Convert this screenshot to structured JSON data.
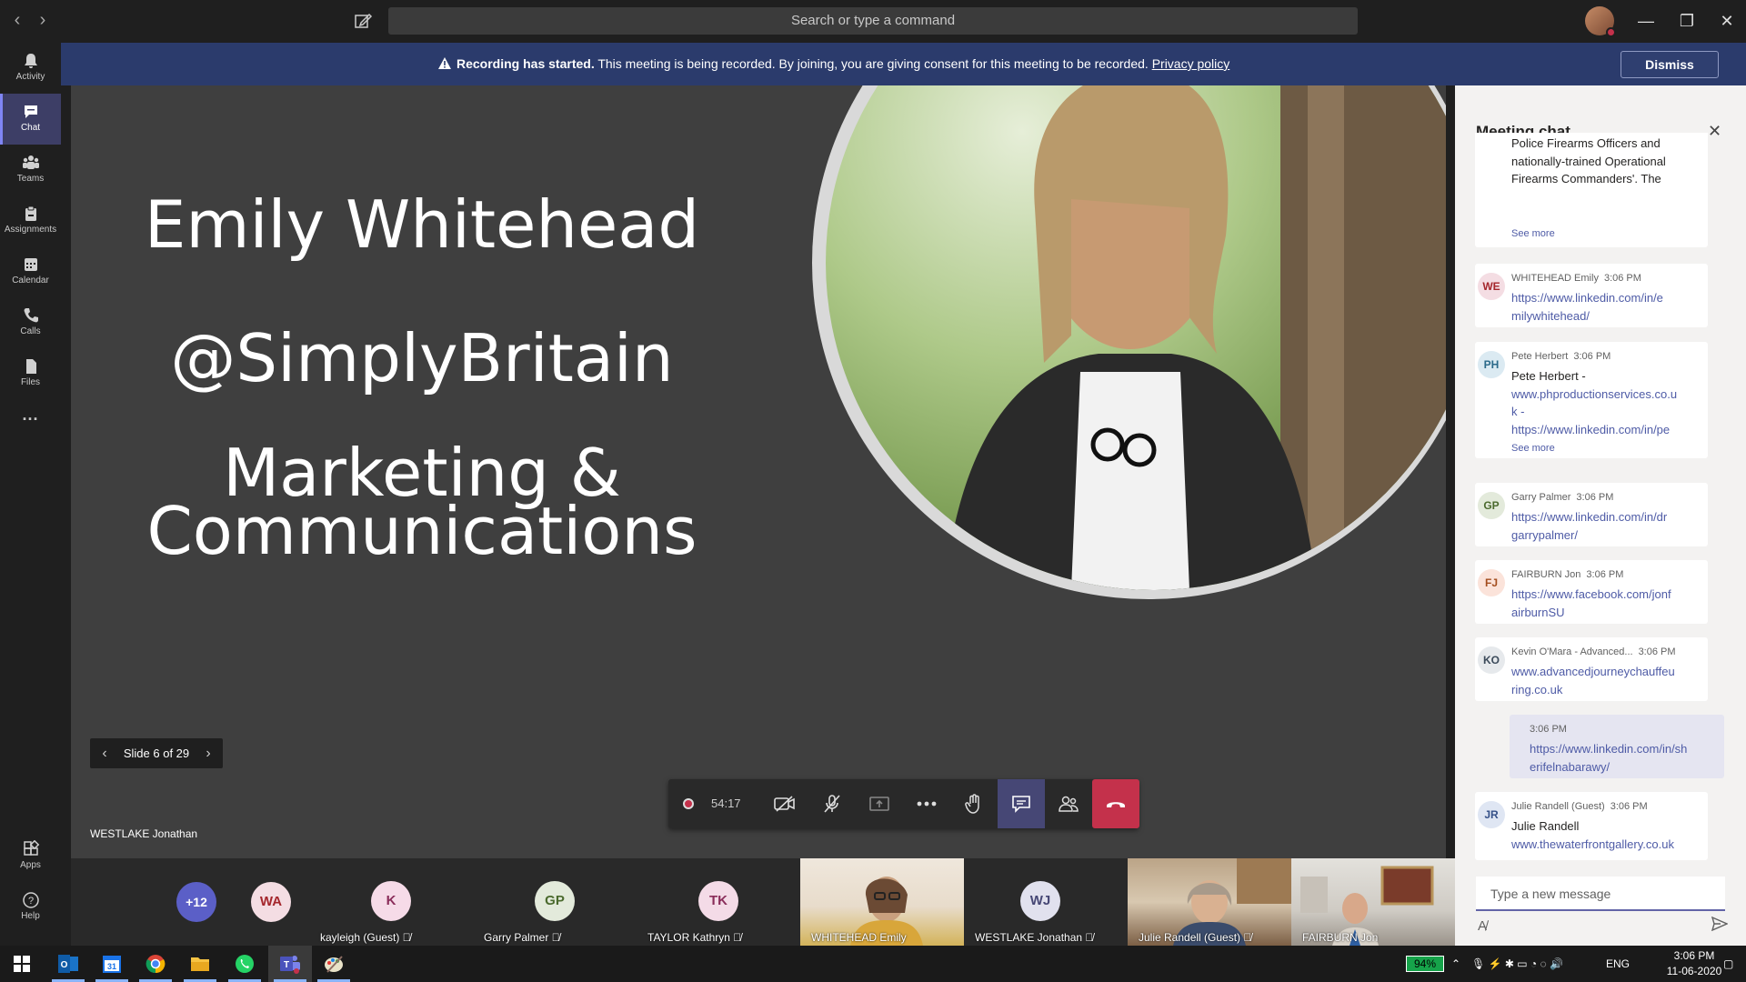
{
  "titlebar": {
    "search_placeholder": "Search or type a command"
  },
  "rail": {
    "items": [
      {
        "label": "Activity",
        "icon": "bell-icon"
      },
      {
        "label": "Chat",
        "icon": "chat-icon",
        "active": true
      },
      {
        "label": "Teams",
        "icon": "teams-icon"
      },
      {
        "label": "Assignments",
        "icon": "assignments-icon"
      },
      {
        "label": "Calendar",
        "icon": "calendar-icon"
      },
      {
        "label": "Calls",
        "icon": "phone-icon"
      },
      {
        "label": "Files",
        "icon": "files-icon"
      },
      {
        "label": "...",
        "icon": "more-icon"
      }
    ],
    "bottom": [
      {
        "label": "Apps",
        "icon": "apps-icon"
      },
      {
        "label": "Help",
        "icon": "help-icon"
      }
    ]
  },
  "banner": {
    "bold": "Recording has started.",
    "text": " This meeting is being recorded. By joining, you are giving consent for this meeting to be recorded. ",
    "link": "Privacy policy",
    "dismiss": "Dismiss"
  },
  "slide": {
    "name": "Emily Whitehead",
    "handle": "@SimplyBritain",
    "line1": "Marketing &",
    "line2": "Communications",
    "nav_label": "Slide 6 of 29"
  },
  "presenter": "WESTLAKE Jonathan",
  "controls": {
    "timer": "54:17"
  },
  "strip": {
    "overflow": "+12",
    "tiles": [
      {
        "initials": "WA",
        "name": "",
        "bg": "#f4dde3",
        "fg": "#a4262c"
      },
      {
        "initials": "K",
        "name": "kayleigh (Guest)",
        "bg": "#f6dbe8",
        "fg": "#8a2d5a"
      },
      {
        "initials": "GP",
        "name": "Garry Palmer",
        "bg": "#e3eadb",
        "fg": "#4b6a2e"
      },
      {
        "initials": "TK",
        "name": "TAYLOR Kathryn",
        "bg": "#f4dbe7",
        "fg": "#8a2d5a"
      },
      {
        "initials": "",
        "name": "WHITEHEAD Emily",
        "video": true
      },
      {
        "initials": "WJ",
        "name": "WESTLAKE Jonathan",
        "bg": "#e1e1ee",
        "fg": "#464775"
      },
      {
        "initials": "",
        "name": "Julie Randell (Guest)",
        "video": true
      },
      {
        "initials": "",
        "name": "FAIRBURN Jon",
        "video": true
      }
    ]
  },
  "chat": {
    "title": "Meeting chat",
    "first_message": {
      "lines": [
        "Police Firearms Officers and",
        "nationally-trained Operational",
        "Firearms Commanders'. The"
      ],
      "see_more": "See more"
    },
    "messages": [
      {
        "initials": "WE",
        "name": "WHITEHEAD Emily",
        "time": "3:06 PM",
        "lines": [
          "https://www.linkedin.com/in/e",
          "milywhitehead/"
        ],
        "bg": "#f4dde3",
        "fg": "#a4262c"
      },
      {
        "initials": "PH",
        "name": "Pete Herbert",
        "time": "3:06 PM",
        "plain": "Pete Herbert -",
        "lines": [
          "www.phproductionservices.co.u",
          "k -",
          "https://www.linkedin.com/in/pe"
        ],
        "see_more": "See more",
        "bg": "#dbeaf2",
        "fg": "#2b6a8a"
      },
      {
        "initials": "GP",
        "name": "Garry Palmer",
        "time": "3:06 PM",
        "lines": [
          "https://www.linkedin.com/in/dr",
          "garrypalmer/"
        ],
        "bg": "#e3eadb",
        "fg": "#4b6a2e"
      },
      {
        "initials": "FJ",
        "name": "FAIRBURN Jon",
        "time": "3:06 PM",
        "lines": [
          "https://www.facebook.com/jonf",
          "airburnSU"
        ],
        "bg": "#fbe3da",
        "fg": "#a34d1e"
      },
      {
        "initials": "KO",
        "name": "Kevin O'Mara - Advanced...",
        "time": "3:06 PM",
        "lines": [
          "www.advancedjourneychauffeu",
          "ring.co.uk"
        ],
        "bg": "#e6e9ec",
        "fg": "#3b4a5a"
      },
      {
        "self": true,
        "time": "3:06 PM",
        "lines": [
          "https://www.linkedin.com/in/sh",
          "erifelnabarawy/"
        ]
      },
      {
        "initials": "JR",
        "name": "Julie Randell (Guest)",
        "time": "3:06 PM",
        "plain": "Julie Randell",
        "lines": [
          "www.thewaterfrontgallery.co.uk"
        ],
        "bg": "#dfe6f3",
        "fg": "#355088"
      }
    ],
    "input_placeholder": "Type a new message"
  },
  "taskbar": {
    "battery": "94%",
    "lang": "ENG",
    "time": "3:06 PM",
    "date": "11-06-2020",
    "apps": [
      "windows-start-icon",
      "outlook-icon",
      "calendar-app-icon",
      "chrome-icon",
      "file-explorer-icon",
      "whatsapp-icon",
      "teams-app-icon",
      "paint-icon"
    ]
  }
}
